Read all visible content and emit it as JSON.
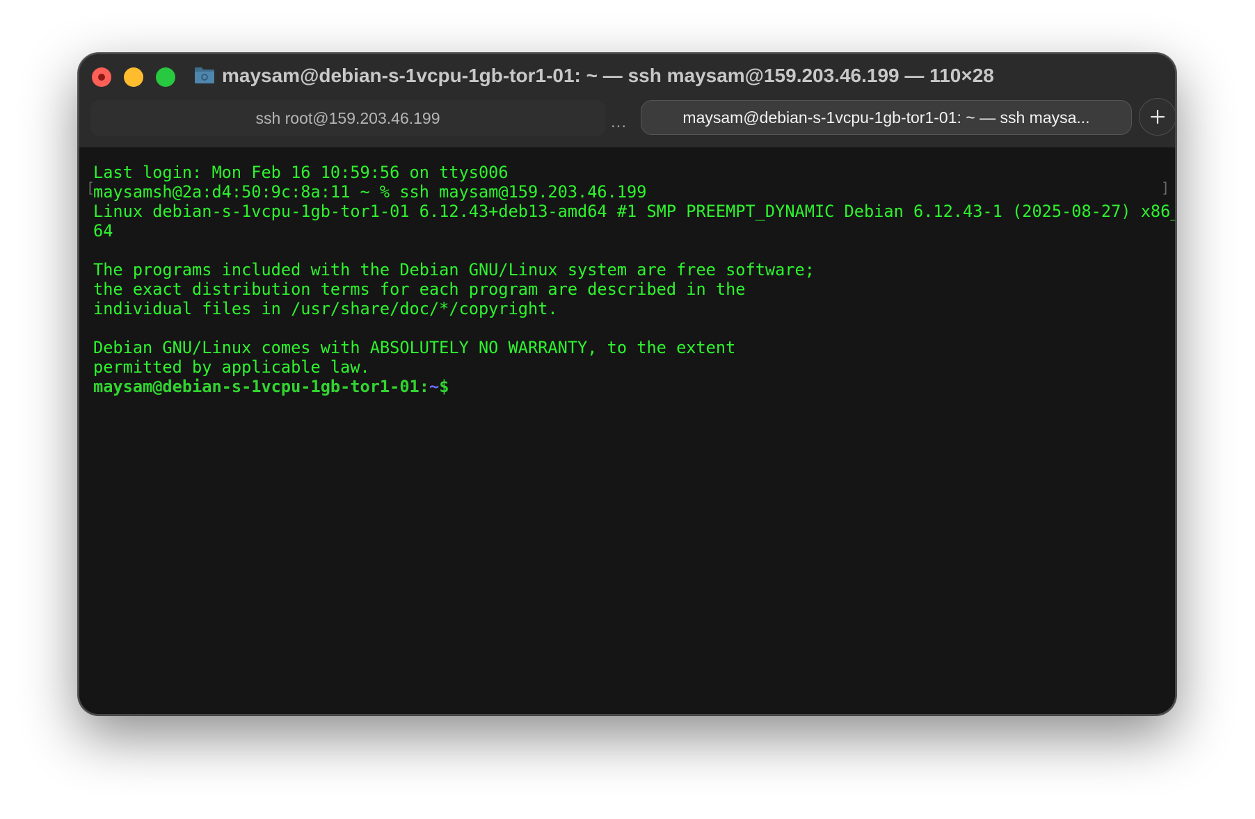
{
  "window": {
    "title": "maysam@debian-s-1vcpu-1gb-tor1-01: ~ — ssh maysam@159.203.46.199 — 110×28"
  },
  "tabs": [
    {
      "label": "ssh root@159.203.46.199",
      "active": false
    },
    {
      "label": "maysam@debian-s-1vcpu-1gb-tor1-01: ~ — ssh maysa...",
      "active": true
    }
  ],
  "tab_overflow": "...",
  "add_tab_icon": "plus-icon",
  "terminal": {
    "lines": [
      "Last login: Mon Feb 16 10:59:56 on ttys006",
      "maysamsh@2a:d4:50:9c:8a:11 ~ % ssh maysam@159.203.46.199",
      "Linux debian-s-1vcpu-1gb-tor1-01 6.12.43+deb13-amd64 #1 SMP PREEMPT_DYNAMIC Debian 6.12.43-1 (2025-08-27) x86_",
      "64",
      "",
      "The programs included with the Debian GNU/Linux system are free software;",
      "the exact distribution terms for each program are described in the",
      "individual files in /usr/share/doc/*/copyright.",
      "",
      "Debian GNU/Linux comes with ABSOLUTELY NO WARRANTY, to the extent",
      "permitted by applicable law."
    ],
    "prompt": {
      "user_host": "maysam@debian-s-1vcpu-1gb-tor1-01",
      "separator": ":",
      "path": "~",
      "symbol": "$"
    }
  },
  "colors": {
    "text_green": "#2ef32e",
    "prompt_path": "#6d6df5",
    "background": "#151515",
    "titlebar": "#2b2b2b"
  }
}
